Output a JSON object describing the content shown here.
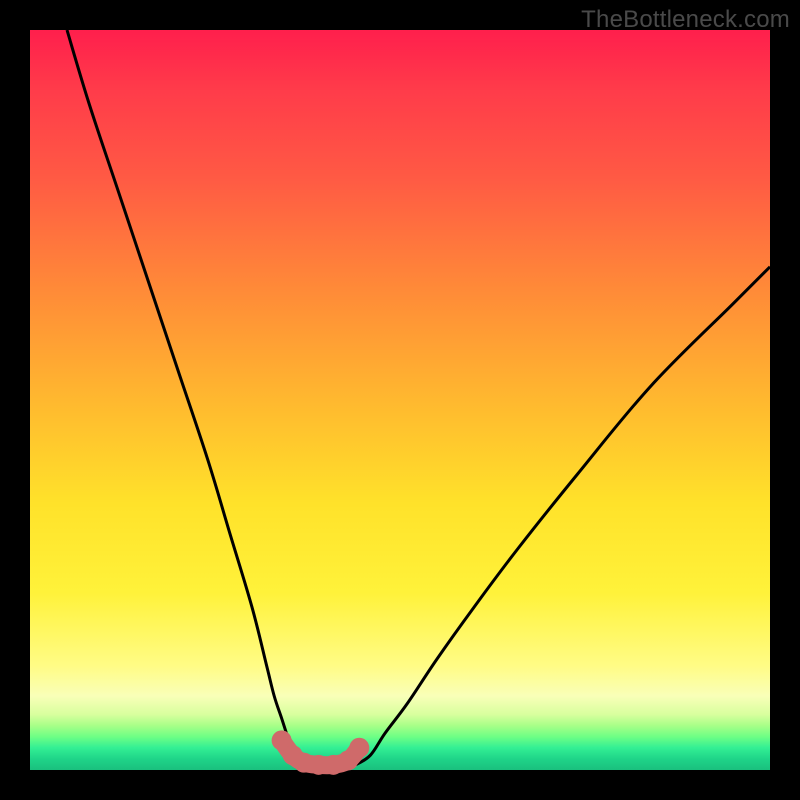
{
  "watermark": "TheBottleneck.com",
  "colors": {
    "curve_stroke": "#000000",
    "marker_fill": "#cf6a6a",
    "marker_stroke": "#c35a5a"
  },
  "chart_data": {
    "type": "line",
    "title": "",
    "xlabel": "",
    "ylabel": "",
    "xlim": [
      0,
      100
    ],
    "ylim": [
      0,
      100
    ],
    "series": [
      {
        "name": "left-curve",
        "x": [
          5,
          8,
          12,
          16,
          20,
          24,
          27,
          30,
          32,
          33,
          34,
          35,
          36,
          37,
          38
        ],
        "y": [
          100,
          90,
          78,
          66,
          54,
          42,
          32,
          22,
          14,
          10,
          7,
          4,
          2,
          1,
          0.7
        ]
      },
      {
        "name": "right-curve",
        "x": [
          44,
          46,
          48,
          51,
          55,
          60,
          66,
          74,
          84,
          95,
          100
        ],
        "y": [
          0.7,
          2,
          5,
          9,
          15,
          22,
          30,
          40,
          52,
          63,
          68
        ]
      }
    ],
    "markers": {
      "name": "valley-markers",
      "x": [
        34,
        35.5,
        37,
        39,
        41,
        43,
        44.5
      ],
      "y": [
        4,
        2,
        1,
        0.7,
        0.7,
        1.3,
        3
      ]
    }
  }
}
